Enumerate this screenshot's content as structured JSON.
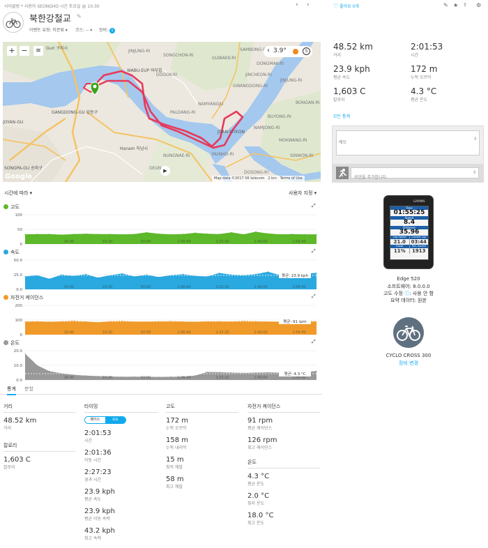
{
  "header": {
    "breadcrumb": "사이클링  *  사용자 SEONGHO 시간 토요일 @ 10:30",
    "title": "북한강철교",
    "event_type": "이벤트 유형: 미분류",
    "course": "코스: --",
    "gear": "장비:",
    "gear_count": "1",
    "like_label": "좋아요 0개"
  },
  "map": {
    "temperature": "3.9°",
    "attribution": "Map data ©2017 SK telecom",
    "scale": "2 km",
    "terms": "Terms of Use",
    "google": "Google",
    "places": [
      "Guri 구리시",
      "WABU-EUP 와부읍",
      "GANGDONG-GU 강동구",
      "Hanam 하남시",
      "SONGPA-GU 송파구",
      "JOYAN-GU",
      "NAMYANGJU",
      "JOAN-MYEON",
      "SAMBONG-RI",
      "JINJUNG-RI",
      "DOGOK-RI",
      "SONGCHON-RI",
      "DONGMAK-RI",
      "JINJUNG-RI",
      "PALDANG-RI",
      "BUYONG-RI",
      "NUNGNAE-RI",
      "OEUN-RI",
      "MUNHO-RI",
      "MOKWANG-RI",
      "SINWON-RI",
      "DOSONG-RI",
      "BONGAN-RI",
      "GWANGDONG-RI",
      "JINCHEON-RI",
      "NAMJONG-RI",
      "GUIBAEK-RI"
    ]
  },
  "chart_section": {
    "time_label": "시간에 따라",
    "user_setting": "사용자 지정"
  },
  "chart_data": [
    {
      "type": "area",
      "title": "고도",
      "x_labels": [
        "16:40",
        "33:20",
        "50:00",
        "1:06:40",
        "1:23:20",
        "1:40:00",
        "1:56:40"
      ],
      "yticks": [
        100,
        50,
        0
      ],
      "ylim": [
        0,
        100
      ],
      "color": "#5db82a",
      "x": [
        0,
        5,
        10,
        15,
        20,
        25,
        30,
        35,
        40,
        45,
        50,
        55,
        60,
        65,
        70,
        75,
        80,
        85,
        90,
        95,
        100,
        105,
        110,
        115,
        120
      ],
      "values": [
        33,
        34,
        34,
        32,
        34,
        35,
        34,
        34,
        33,
        34,
        40,
        35,
        33,
        34,
        38,
        35,
        34,
        40,
        33,
        42,
        36,
        33,
        34,
        33,
        33
      ]
    },
    {
      "type": "area",
      "title": "속도",
      "x_labels": [
        "16:40",
        "33:20",
        "50:00",
        "1:06:40",
        "1:23:20",
        "1:40:00",
        "1:56:40"
      ],
      "yticks": [
        50.0,
        25.0,
        0.0
      ],
      "ylim": [
        0,
        50
      ],
      "color": "#2aa8e0",
      "avg_label": "평균: 23.9 kph",
      "average": 23.9,
      "x": [
        0,
        5,
        10,
        15,
        20,
        25,
        30,
        35,
        40,
        45,
        50,
        55,
        60,
        65,
        70,
        75,
        80,
        85,
        90,
        95,
        100,
        105,
        110,
        115,
        120
      ],
      "values": [
        22,
        24,
        18,
        25,
        23,
        26,
        20,
        24,
        27,
        22,
        25,
        21,
        24,
        26,
        23,
        22,
        28,
        25,
        24,
        26,
        30,
        24,
        25,
        27,
        28
      ]
    },
    {
      "type": "area",
      "title": "자전거 케이던스",
      "x_labels": [
        "16:40",
        "33:20",
        "50:00",
        "1:06:40",
        "1:23:20",
        "1:40:00",
        "1:56:40"
      ],
      "yticks": [
        200,
        100,
        0
      ],
      "ylim": [
        0,
        200
      ],
      "color": "#f09a2a",
      "avg_label": "평균: 91 rpm",
      "average": 91,
      "x": [
        0,
        5,
        10,
        15,
        20,
        25,
        30,
        35,
        40,
        45,
        50,
        55,
        60,
        65,
        70,
        75,
        80,
        85,
        90,
        95,
        100,
        105,
        110,
        115,
        120
      ],
      "values": [
        90,
        92,
        88,
        91,
        95,
        90,
        85,
        92,
        94,
        90,
        89,
        91,
        93,
        90,
        88,
        92,
        91,
        90,
        94,
        92,
        90,
        89,
        91,
        93,
        92
      ]
    },
    {
      "type": "area",
      "title": "온도",
      "x_labels": [
        "16:40",
        "33:20",
        "50:00",
        "1:06:40",
        "1:23:20",
        "1:40:00",
        "1:56:40"
      ],
      "yticks": [
        20.0,
        10.0,
        0.0
      ],
      "ylim": [
        0,
        20
      ],
      "color": "#999999",
      "avg_label": "평균: 4.3 °C",
      "average": 4.3,
      "x": [
        0,
        5,
        10,
        15,
        20,
        25,
        30,
        35,
        40,
        45,
        50,
        55,
        60,
        65,
        70,
        75,
        80,
        85,
        90,
        95,
        100,
        105,
        110,
        115,
        120
      ],
      "values": [
        18,
        10,
        6,
        4.5,
        3.5,
        3,
        2.6,
        2.4,
        2.2,
        2.3,
        2.2,
        2.1,
        2.2,
        2.3,
        3,
        5.5,
        5.3,
        5,
        4.8,
        5,
        5.2,
        5,
        4.8,
        5.2,
        6.2
      ]
    }
  ],
  "tabs": [
    "통계",
    "분할"
  ],
  "stats": {
    "distance": {
      "header": "거리",
      "value": "48.52 km",
      "label": "거리"
    },
    "calories": {
      "header": "칼로리",
      "value": "1,603 C",
      "label": "칼로리"
    },
    "timing": {
      "header": "타이밍",
      "toggle": [
        "페이스",
        "속도"
      ],
      "rows": [
        {
          "value": "2:01:53",
          "label": "시간"
        },
        {
          "value": "2:01:36",
          "label": "이동 시간"
        },
        {
          "value": "2:27:23",
          "label": "경과 시간"
        },
        {
          "value": "23.9 kph",
          "label": "평균 속도"
        },
        {
          "value": "23.9 kph",
          "label": "평균 이동 속력"
        },
        {
          "value": "43.2 kph",
          "label": "최고 속력"
        }
      ]
    },
    "elevation": {
      "header": "고도",
      "rows": [
        {
          "value": "172 m",
          "label": "누적 오르막"
        },
        {
          "value": "158 m",
          "label": "누적 내리막"
        },
        {
          "value": "15 m",
          "label": "최저 해발"
        },
        {
          "value": "58 m",
          "label": "최고 해발"
        }
      ]
    },
    "cadence": {
      "header": "자전거 케이던스",
      "rows": [
        {
          "value": "91 rpm",
          "label": "평균 케이던스"
        },
        {
          "value": "126 rpm",
          "label": "최고 케이던스"
        }
      ]
    },
    "temperature": {
      "header": "온도",
      "rows": [
        {
          "value": "4.3 °C",
          "label": "평균 온도"
        },
        {
          "value": "2.0 °C",
          "label": "최저 온도"
        },
        {
          "value": "18.0 °C",
          "label": "최고 온도"
        }
      ]
    }
  },
  "right": {
    "summary": [
      {
        "value": "48.52 km",
        "label": "거리"
      },
      {
        "value": "2:01:53",
        "label": "시간"
      },
      {
        "value": "23.9 kph",
        "label": "평균 속도"
      },
      {
        "value": "172 m",
        "label": "누적 오르막"
      },
      {
        "value": "1,603 C",
        "label": "칼로리"
      },
      {
        "value": "4.3 °C",
        "label": "평균 온도"
      }
    ],
    "all_stats": "모든 통계",
    "notes_placeholder": "메모",
    "comment_placeholder": "의견을 추가합니다.",
    "device": {
      "brand": "GARMIN",
      "screen": {
        "time_label": "Time",
        "time": "01:55:25",
        "speed_label": "Speed",
        "speed": "8.4",
        "distance_label": "Distance",
        "distance": "35.96",
        "lap_speed_label": "Lap Speed",
        "lap_speed": "21.0",
        "cur_lap_label": "Current Lap",
        "cur_lap": "03:44",
        "grade_label": "Grade",
        "grade": "11%",
        "ascent_label": "Totl. Ascent",
        "ascent": "1913"
      },
      "name": "Edge 520",
      "software": "소프트웨어: 8.0.0.0",
      "elev_corr": "고도 수정",
      "elev_corr_value": ": 사용 안 함",
      "source": "요약 데이터: 원본"
    },
    "bike": {
      "name": "CYCLO CROSS 300",
      "change": "장비 변경"
    }
  }
}
